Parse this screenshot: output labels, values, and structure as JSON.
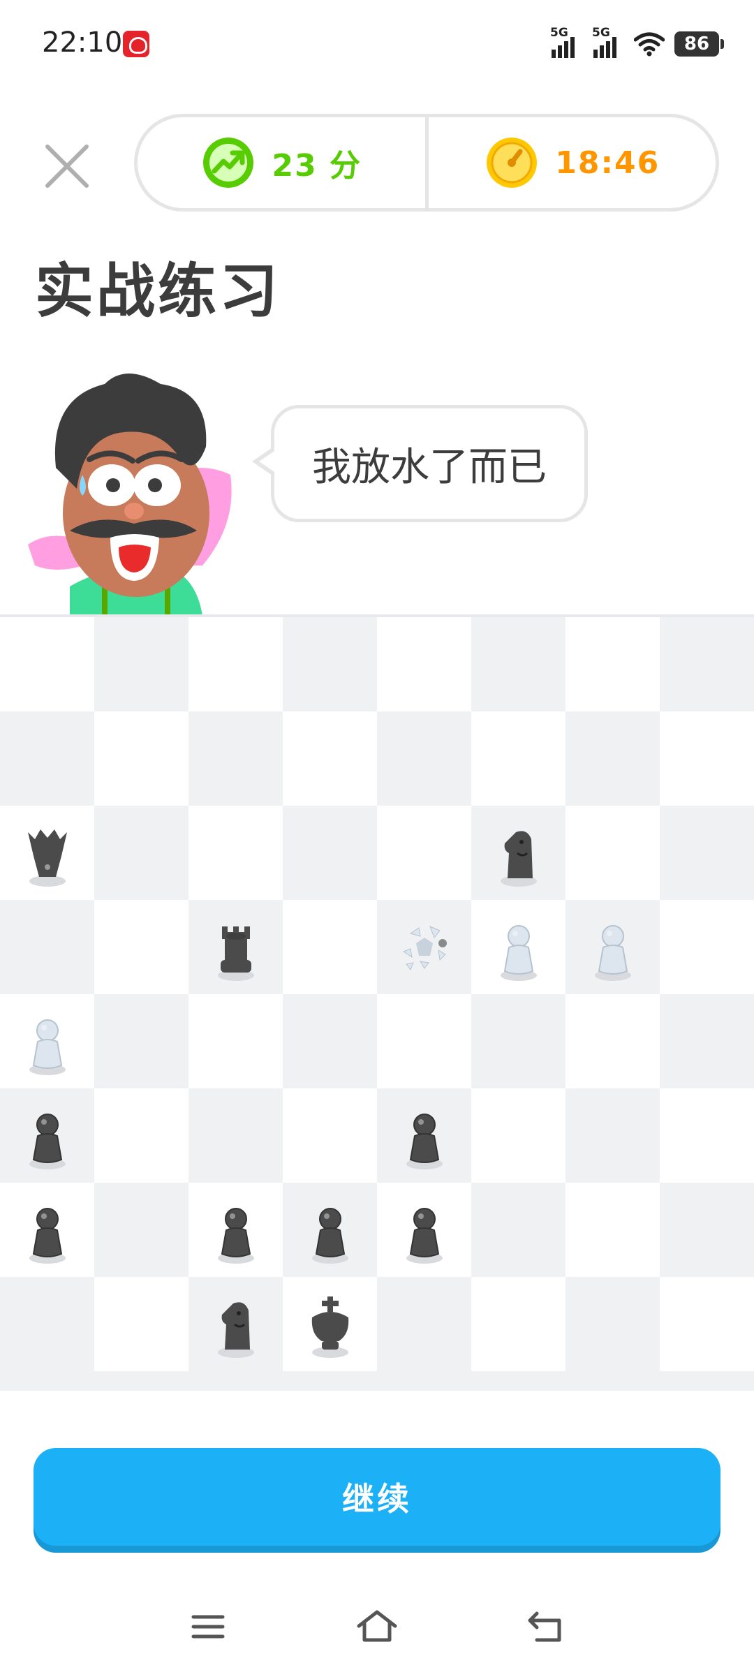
{
  "status_bar": {
    "time": "22:10",
    "network_1": "5G",
    "network_2": "5G",
    "battery": "86"
  },
  "header": {
    "score": "23 分",
    "timer": "18:46"
  },
  "title": "实战练习",
  "speech": "我放水了而已",
  "board": {
    "rows": [
      [
        "",
        "",
        "",
        "",
        "",
        "",
        "",
        ""
      ],
      [
        "",
        "",
        "",
        "",
        "",
        "",
        "",
        ""
      ],
      [
        "queen-black",
        "",
        "",
        "",
        "",
        "knight-black",
        "",
        ""
      ],
      [
        "",
        "",
        "rook-black",
        "",
        "captured-white-king",
        "pawn-white",
        "pawn-white",
        ""
      ],
      [
        "pawn-white",
        "",
        "",
        "",
        "",
        "",
        "",
        ""
      ],
      [
        "pawn-black",
        "",
        "",
        "",
        "pawn-black",
        "",
        "",
        ""
      ],
      [
        "pawn-black",
        "",
        "pawn-black",
        "pawn-black",
        "pawn-black",
        "",
        "",
        ""
      ],
      [
        "",
        "",
        "knight-black",
        "king-black",
        "",
        "",
        "",
        ""
      ]
    ]
  },
  "continue_label": "继续",
  "colors": {
    "accent_blue": "#1cb0f6",
    "score_green": "#58cc02",
    "timer_orange": "#ff9600",
    "dark_piece": "#4b4b4b",
    "light_piece": "#dde6ee"
  }
}
